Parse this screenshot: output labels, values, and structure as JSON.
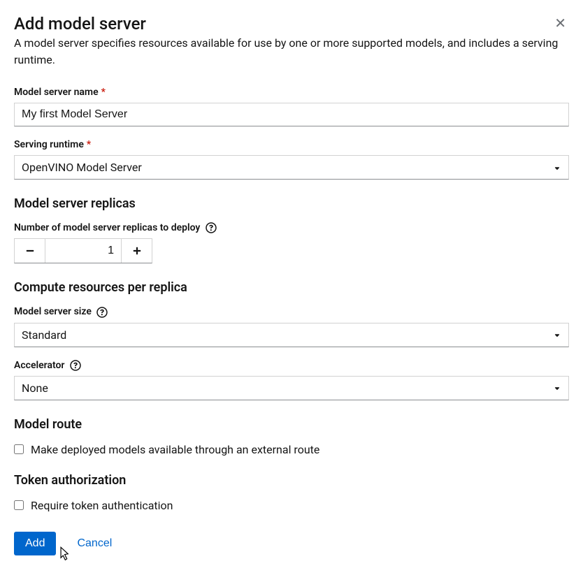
{
  "header": {
    "title": "Add model server",
    "description": "A model server specifies resources available for use by one or more supported models, and includes a serving runtime."
  },
  "fields": {
    "name": {
      "label": "Model server name",
      "value": "My first Model Server"
    },
    "runtime": {
      "label": "Serving runtime",
      "value": "OpenVINO Model Server"
    }
  },
  "replicas": {
    "heading": "Model server replicas",
    "count_label": "Number of model server replicas to deploy",
    "count_value": "1"
  },
  "compute": {
    "heading": "Compute resources per replica",
    "size_label": "Model server size",
    "size_value": "Standard",
    "accel_label": "Accelerator",
    "accel_value": "None"
  },
  "route": {
    "heading": "Model route",
    "checkbox_label": "Make deployed models available through an external route"
  },
  "token": {
    "heading": "Token authorization",
    "checkbox_label": "Require token authentication"
  },
  "footer": {
    "add": "Add",
    "cancel": "Cancel"
  }
}
